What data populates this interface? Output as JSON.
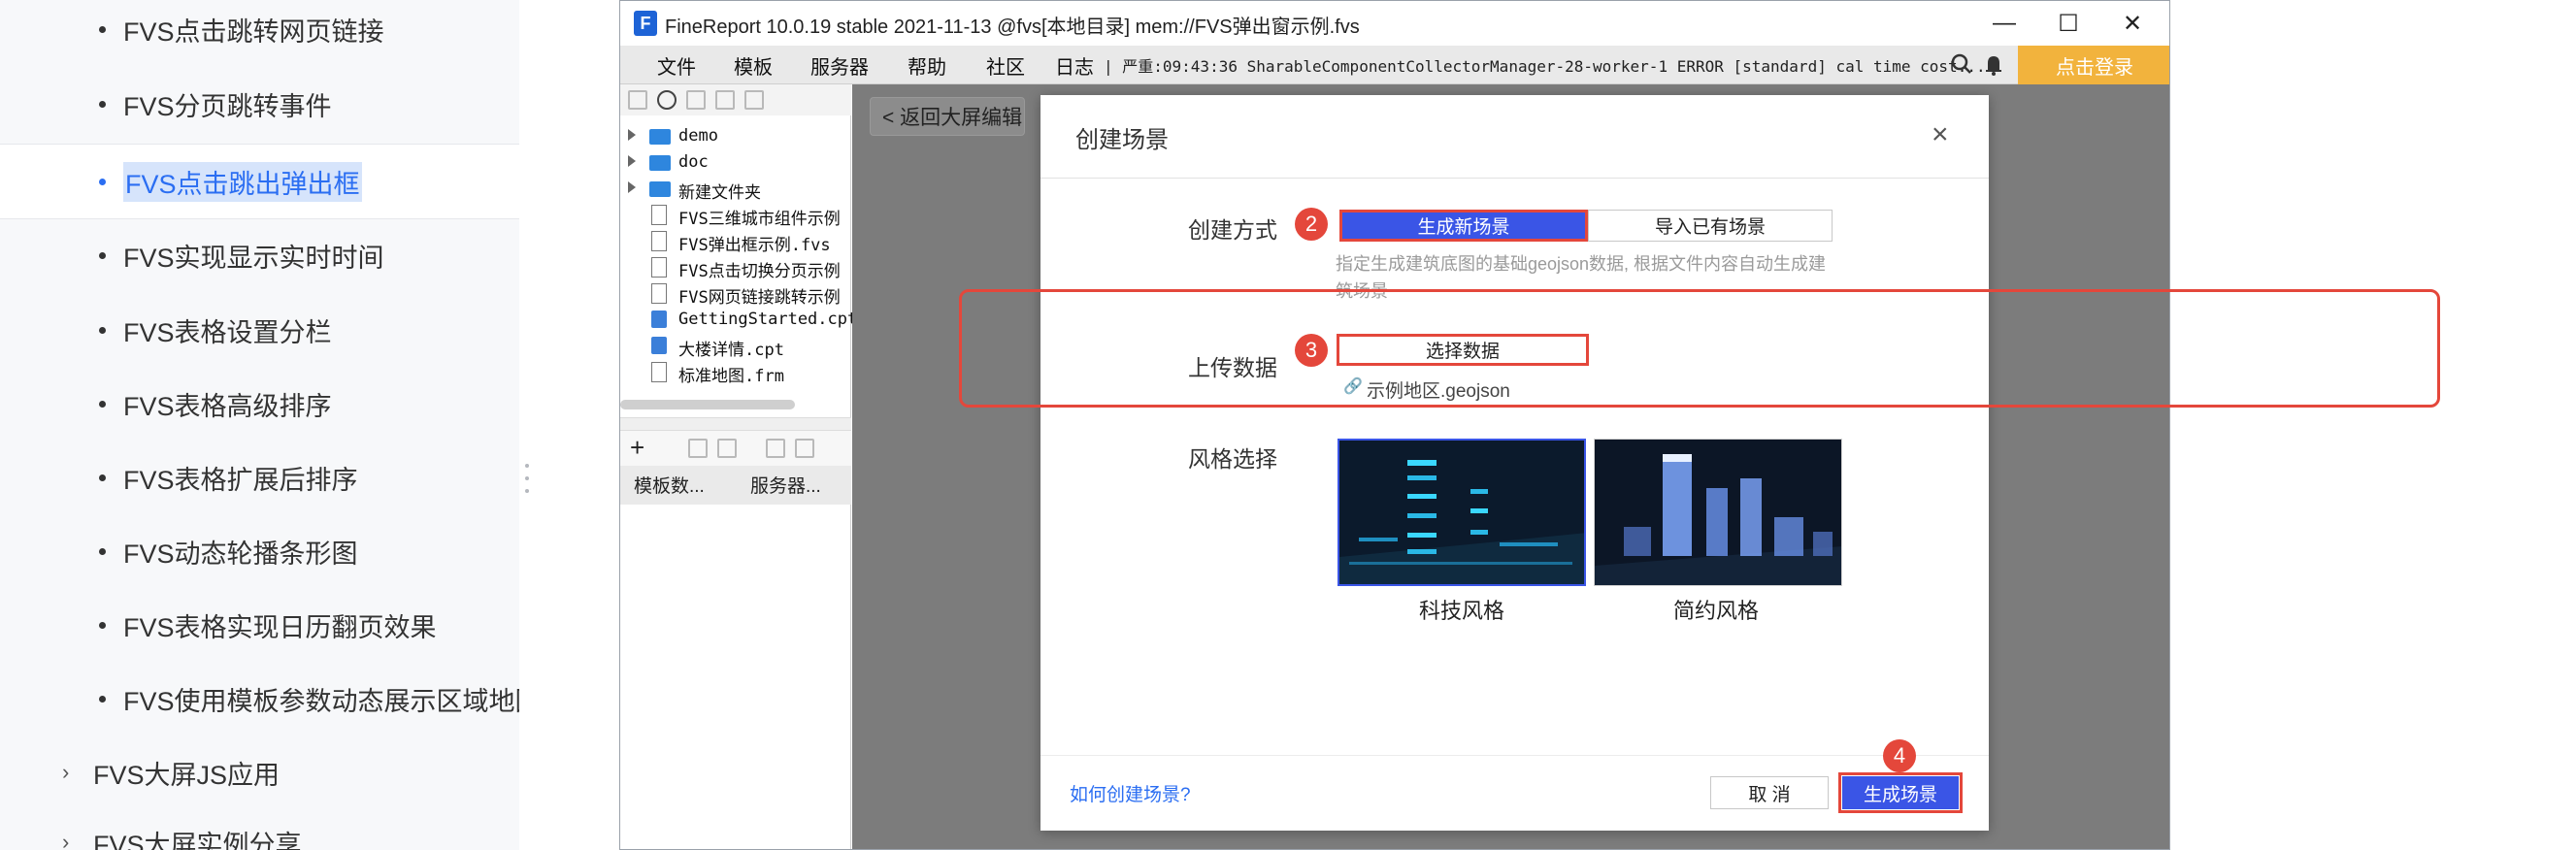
{
  "doc_sidebar": {
    "items": [
      {
        "label": "FVS点击跳转网页链接"
      },
      {
        "label": "FVS分页跳转事件"
      },
      {
        "label": "FVS点击跳出弹出框",
        "active": true
      },
      {
        "label": "FVS实现显示实时时间"
      },
      {
        "label": "FVS表格设置分栏"
      },
      {
        "label": "FVS表格高级排序"
      },
      {
        "label": "FVS表格扩展后排序"
      },
      {
        "label": "FVS动态轮播条形图"
      },
      {
        "label": "FVS表格实现日历翻页效果"
      },
      {
        "label": "FVS使用模板参数动态展示区域地图"
      }
    ],
    "sections": [
      {
        "label": "FVS大屏JS应用"
      },
      {
        "label": "FVS大屏实例分享"
      }
    ]
  },
  "window": {
    "title": "FineReport 10.0.19 stable 2021-11-13 @fvs[本地目录]     mem://FVS弹出窗示例.fvs",
    "logo": "F",
    "minimize": "—",
    "maximize": "☐",
    "close": "✕"
  },
  "menubar": {
    "items": [
      "文件",
      "模板",
      "服务器",
      "帮助",
      "社区",
      "日志"
    ],
    "log_text": "| 严重:09:43:36 SharableComponentCollectorManager-28-worker-1 ERROR [standard] cal time cost...",
    "login_label": "点击登录"
  },
  "tree": {
    "rows": [
      {
        "kind": "folder",
        "label": "demo"
      },
      {
        "kind": "folder",
        "label": "doc"
      },
      {
        "kind": "folder",
        "label": "新建文件夹"
      },
      {
        "kind": "file",
        "label": "FVS三维城市组件示例"
      },
      {
        "kind": "file",
        "label": "FVS弹出框示例.fvs"
      },
      {
        "kind": "file",
        "label": "FVS点击切换分页示例"
      },
      {
        "kind": "file",
        "label": "FVS网页链接跳转示例"
      },
      {
        "kind": "cpt",
        "label": "GettingStarted.cpt"
      },
      {
        "kind": "cpt",
        "label": "大楼详情.cpt"
      },
      {
        "kind": "file",
        "label": "标准地图.frm"
      }
    ],
    "tabs": [
      "模板数...",
      "服务器..."
    ]
  },
  "workspace": {
    "back_label": "< 返回大屏编辑"
  },
  "modal": {
    "title": "创建场景",
    "close": "×",
    "create_mode_label": "创建方式",
    "mode_options": [
      "生成新场景",
      "导入已有场景"
    ],
    "hint": "指定生成建筑底图的基础geojson数据, 根据文件内容自动生成建筑场景",
    "upload_label": "上传数据",
    "select_data_label": "选择数据",
    "file_name": "示例地区.geojson",
    "style_label": "风格选择",
    "styles": [
      "科技风格",
      "简约风格"
    ],
    "help_link": "如何创建场景?",
    "cancel_label": "取 消",
    "create_label": "生成场景",
    "markers": [
      "2",
      "3",
      "4"
    ]
  },
  "colors": {
    "accent": "#3a55e6",
    "annotation_red": "#e4473b",
    "login_orange": "#f2b33d",
    "doc_link_blue": "#2b6ef2"
  }
}
